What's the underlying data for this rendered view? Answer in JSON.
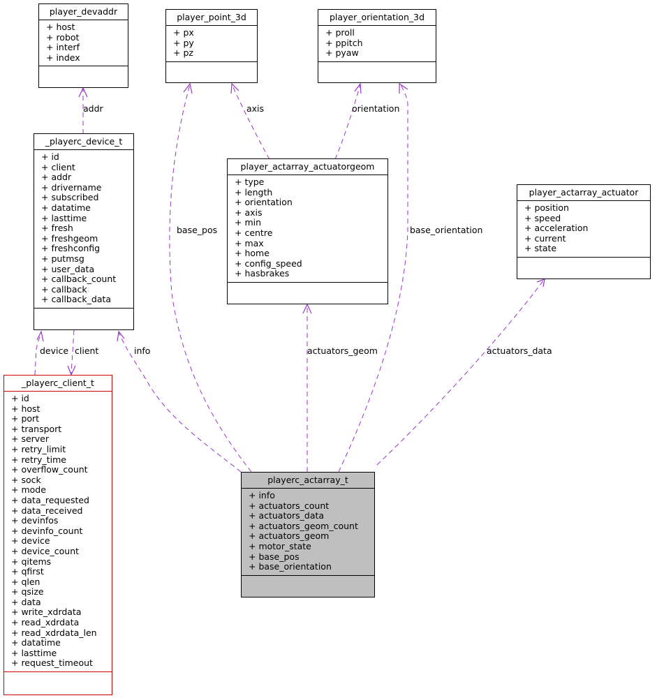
{
  "diagram": {
    "edge_color": "#9933cc",
    "classes": {
      "player_devaddr": {
        "name": "player_devaddr",
        "attributes": [
          "+ host",
          "+ robot",
          "+ interf",
          "+ index"
        ]
      },
      "player_point_3d": {
        "name": "player_point_3d",
        "attributes": [
          "+ px",
          "+ py",
          "+ pz"
        ]
      },
      "player_orientation_3d": {
        "name": "player_orientation_3d",
        "attributes": [
          "+ proll",
          "+ ppitch",
          "+ pyaw"
        ]
      },
      "playerc_device_t": {
        "name": "_playerc_device_t",
        "attributes": [
          "+ id",
          "+ client",
          "+ addr",
          "+ drivername",
          "+ subscribed",
          "+ datatime",
          "+ lasttime",
          "+ fresh",
          "+ freshgeom",
          "+ freshconfig",
          "+ putmsg",
          "+ user_data",
          "+ callback_count",
          "+ callback",
          "+ callback_data"
        ]
      },
      "player_actarray_actuatorgeom": {
        "name": "player_actarray_actuatorgeom",
        "attributes": [
          "+ type",
          "+ length",
          "+ orientation",
          "+ axis",
          "+ min",
          "+ centre",
          "+ max",
          "+ home",
          "+ config_speed",
          "+ hasbrakes"
        ]
      },
      "player_actarray_actuator": {
        "name": "player_actarray_actuator",
        "attributes": [
          "+ position",
          "+ speed",
          "+ acceleration",
          "+ current",
          "+ state"
        ]
      },
      "playerc_client_t": {
        "name": "_playerc_client_t",
        "attributes": [
          "+ id",
          "+ host",
          "+ port",
          "+ transport",
          "+ server",
          "+ retry_limit",
          "+ retry_time",
          "+ overflow_count",
          "+ sock",
          "+ mode",
          "+ data_requested",
          "+ data_received",
          "+ devinfos",
          "+ devinfo_count",
          "+ device",
          "+ device_count",
          "+ qitems",
          "+ qfirst",
          "+ qlen",
          "+ qsize",
          "+ data",
          "+ write_xdrdata",
          "+ read_xdrdata",
          "+ read_xdrdata_len",
          "+ datatime",
          "+ lasttime",
          "+ request_timeout"
        ]
      },
      "playerc_actarray_t": {
        "name": "playerc_actarray_t",
        "attributes": [
          "+ info",
          "+ actuators_count",
          "+ actuators_data",
          "+ actuators_geom_count",
          "+ actuators_geom",
          "+ motor_state",
          "+ base_pos",
          "+ base_orientation"
        ]
      }
    },
    "edge_labels": {
      "addr": "addr",
      "base_pos": "base_pos",
      "axis": "axis",
      "orientation": "orientation",
      "base_orientation": "base_orientation",
      "actuators_geom": "actuators_geom",
      "actuators_data": "actuators_data",
      "device": "device",
      "client": "client",
      "info": "info"
    }
  }
}
